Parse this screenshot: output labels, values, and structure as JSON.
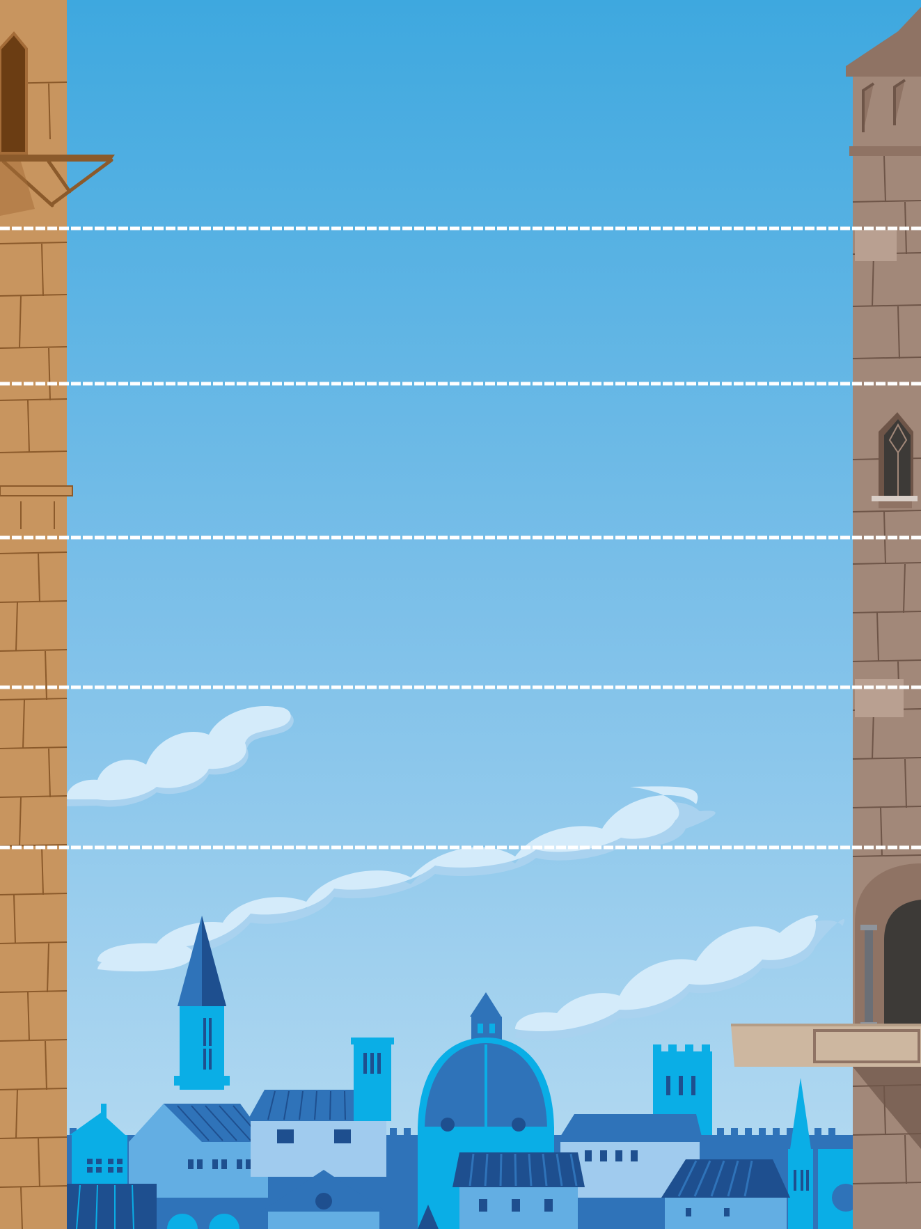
{
  "scene": {
    "colors": {
      "sky_top": "#3ea8df",
      "sky_bottom": "#b7dcf2",
      "cloud": "#d4ebfa",
      "cloud_shadow": "#a9d2ef",
      "rope": "#ffffff",
      "left_tower": "#c8955f",
      "left_tower_line": "#8b5a2b",
      "right_tower": "#a28879",
      "right_tower_line": "#6e5548",
      "city_dark": "#1e4f8f",
      "city_mid": "#2f73b9",
      "city_light": "#63aee3",
      "city_cyan": "#0aaee6"
    },
    "ropes": {
      "count": 5
    },
    "objects": [
      "left-tower",
      "right-tower",
      "left-balcony",
      "right-balcony",
      "city-skyline",
      "clouds",
      "ropes"
    ]
  }
}
